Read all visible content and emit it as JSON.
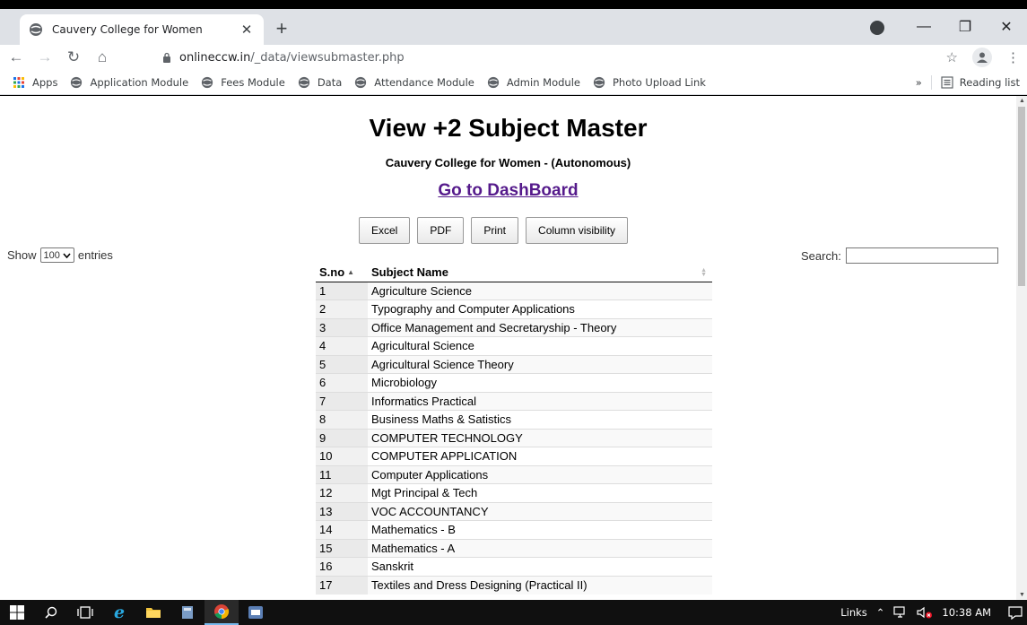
{
  "browser": {
    "tab_title": "Cauvery College for Women",
    "url_host": "onlineccw.in",
    "url_path": "/_data/viewsubmaster.php",
    "bookmarks": [
      "Apps",
      "Application Module",
      "Fees Module",
      "Data",
      "Attendance Module",
      "Admin Module",
      "Photo Upload Link"
    ],
    "reading_list": "Reading list"
  },
  "page": {
    "title": "View +2 Subject Master",
    "subtitle": "Cauvery College for Women - (Autonomous)",
    "dashboard_link": "Go to DashBoard",
    "buttons": [
      "Excel",
      "PDF",
      "Print",
      "Column visibility"
    ],
    "show_label": "Show",
    "entries_value": "100",
    "entries_label": "entries",
    "search_label": "Search:"
  },
  "table": {
    "headers": [
      "S.no",
      "Subject Name"
    ],
    "rows": [
      [
        "1",
        "Agriculture Science"
      ],
      [
        "2",
        "Typography and Computer Applications"
      ],
      [
        "3",
        "Office Management and Secretaryship - Theory"
      ],
      [
        "4",
        "Agricultural Science"
      ],
      [
        "5",
        "Agricultural Science Theory"
      ],
      [
        "6",
        "Microbiology"
      ],
      [
        "7",
        "Informatics Practical"
      ],
      [
        "8",
        "Business Maths & Satistics"
      ],
      [
        "9",
        "COMPUTER TECHNOLOGY"
      ],
      [
        "10",
        "COMPUTER APPLICATION"
      ],
      [
        "11",
        "Computer Applications"
      ],
      [
        "12",
        "Mgt Principal & Tech"
      ],
      [
        "13",
        "VOC ACCOUNTANCY"
      ],
      [
        "14",
        "Mathematics - B"
      ],
      [
        "15",
        "Mathematics - A"
      ],
      [
        "16",
        "Sanskrit"
      ],
      [
        "17",
        "Textiles and Dress Designing (Practical II)"
      ]
    ]
  },
  "taskbar": {
    "links_label": "Links",
    "time": "10:38 AM"
  }
}
